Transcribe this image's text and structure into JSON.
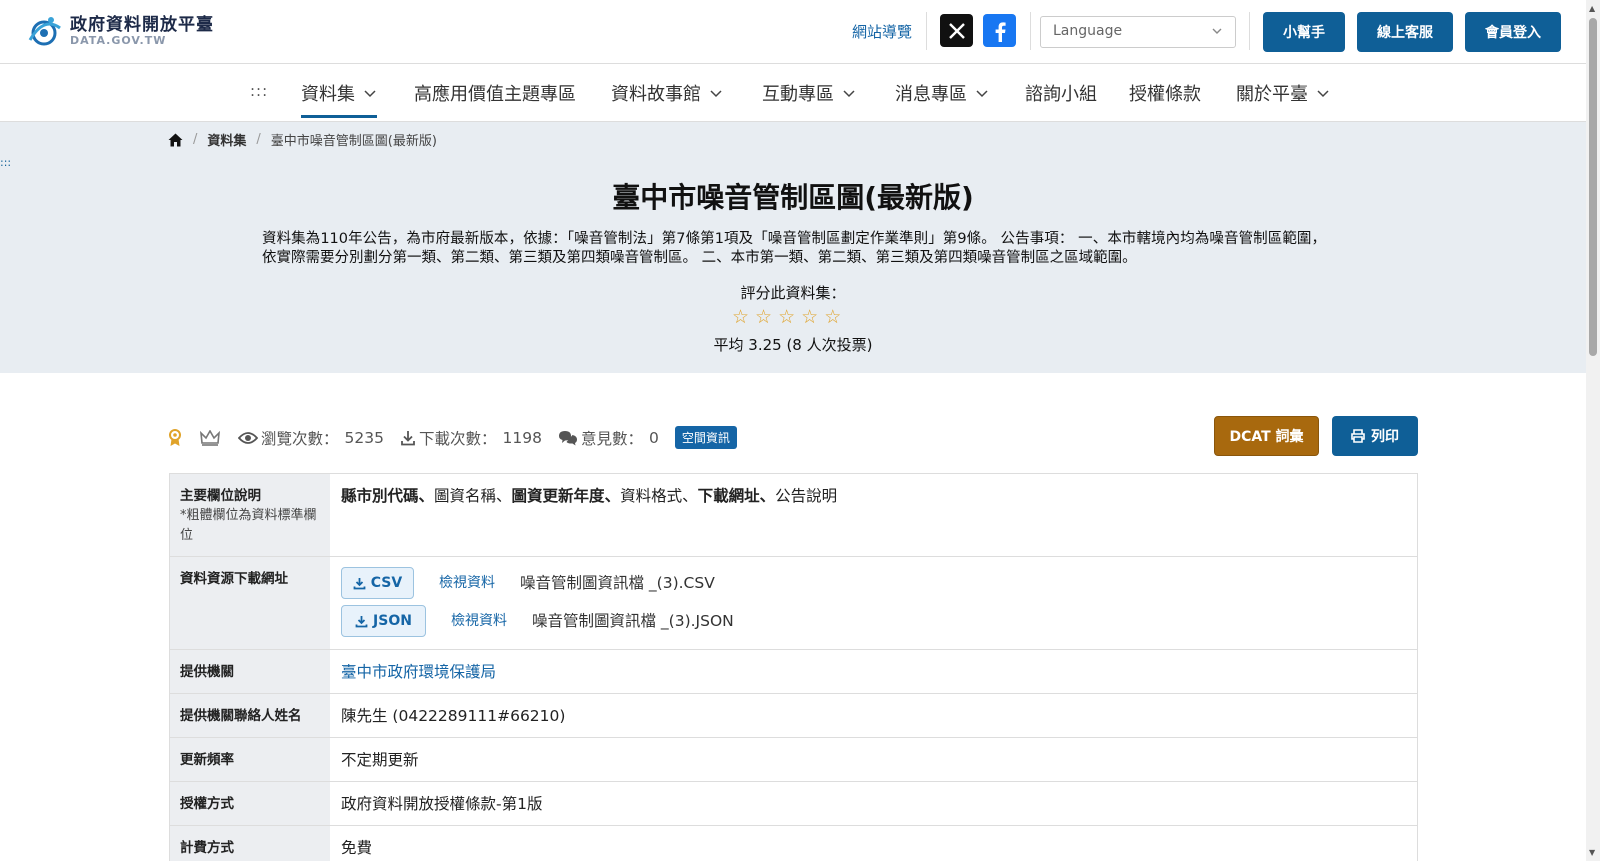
{
  "header": {
    "logo_title": "政府資料開放平臺",
    "logo_sub": "DATA.GOV.TW",
    "sitemap": "網站導覽",
    "language_placeholder": "Language",
    "buttons": [
      "小幫手",
      "線上客服",
      "會員登入"
    ],
    "colors": {
      "primary": "#0f5f97",
      "accent": "#a8690e"
    }
  },
  "nav": {
    "dots": ":::",
    "items": [
      {
        "label": "資料集",
        "dropdown": true
      },
      {
        "label": "高應用價值主題專區",
        "dropdown": false
      },
      {
        "label": "資料故事館",
        "dropdown": true
      },
      {
        "label": "互動專區",
        "dropdown": true
      },
      {
        "label": "消息專區",
        "dropdown": true
      },
      {
        "label": "諮詢小組",
        "dropdown": false
      },
      {
        "label": "授權條款",
        "dropdown": false
      },
      {
        "label": "關於平臺",
        "dropdown": true
      }
    ]
  },
  "breadcrumb": {
    "home_icon": "home-icon",
    "items": [
      "資料集",
      "臺中市噪音管制區圖(最新版)"
    ]
  },
  "side_dots": ":::",
  "dataset": {
    "title": "臺中市噪音管制區圖(最新版)",
    "description": "資料集為110年公告，為市府最新版本，依據：「噪音管制法」第7條第1項及「噪音管制區劃定作業準則」第9條。 公告事項： 一、本市轄境內均為噪音管制區範圍，依實際需要分別劃分第一類、第二類、第三類及第四類噪音管制區。 二、本市第一類、第二類、第三類及第四類噪音管制區之區域範圍。",
    "rate_label": "評分此資料集：",
    "average": "平均 3.25 (8 人次投票)"
  },
  "stats": {
    "views_label": "瀏覽次數：",
    "views": "5235",
    "downloads_label": "下載次數：",
    "downloads": "1198",
    "comments_label": "意見數：",
    "comments": "0",
    "tag": "空間資訊"
  },
  "actions": {
    "dcat": "DCAT 詞彙",
    "print": "列印"
  },
  "table": {
    "fields_label": "主要欄位說明",
    "fields_note": "*粗體欄位為資料標準欄位",
    "fields": [
      {
        "text": "縣市別代碼",
        "bold": true
      },
      {
        "text": "、",
        "bold": true
      },
      {
        "text": "圖資名稱、",
        "bold": false
      },
      {
        "text": "圖資更新年度",
        "bold": true
      },
      {
        "text": "、",
        "bold": true
      },
      {
        "text": "資料格式、",
        "bold": false
      },
      {
        "text": "下載網址",
        "bold": true
      },
      {
        "text": "、",
        "bold": true
      },
      {
        "text": "公告說明",
        "bold": false
      }
    ],
    "resources_label": "資料資源下載網址",
    "resources": [
      {
        "format": "CSV",
        "view": "檢視資料",
        "file": "噪音管制圖資訊檔 _(3).CSV"
      },
      {
        "format": "JSON",
        "view": "檢視資料",
        "file": "噪音管制圖資訊檔 _(3).JSON"
      }
    ],
    "rows": [
      {
        "label": "提供機關",
        "value": "臺中市政府環境保護局",
        "link": true
      },
      {
        "label": "提供機關聯絡人姓名",
        "value": "陳先生 (0422289111#66210)",
        "link": false
      },
      {
        "label": "更新頻率",
        "value": "不定期更新",
        "link": false
      },
      {
        "label": "授權方式",
        "value": "政府資料開放授權條款-第1版",
        "link": false
      },
      {
        "label": "計費方式",
        "value": "免費",
        "link": false
      }
    ]
  }
}
